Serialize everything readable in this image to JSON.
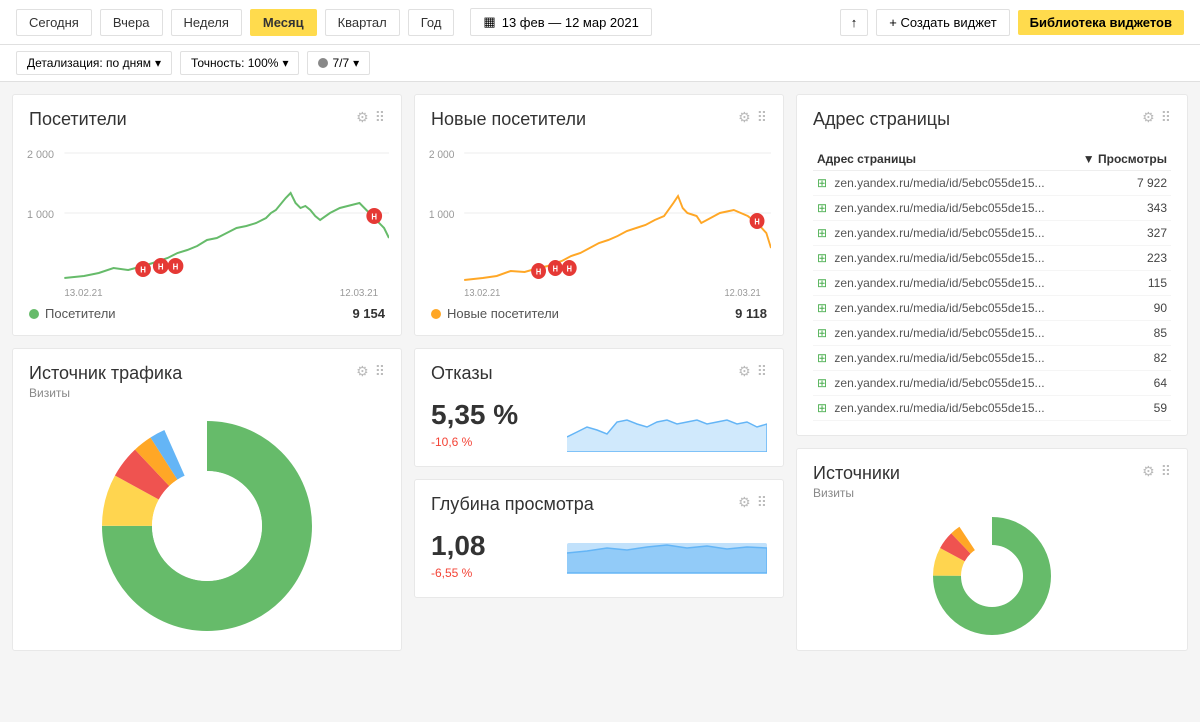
{
  "toolbar": {
    "periods": [
      "Сегодня",
      "Вчера",
      "Неделя",
      "Месяц",
      "Квартал",
      "Год"
    ],
    "active_period": "Месяц",
    "date_range": "13 фев — 12 мар 2021",
    "upload_label": "↑",
    "create_widget_label": "+ Создать виджет",
    "library_label": "Библиотека виджетов"
  },
  "toolbar2": {
    "detail_label": "Детализация: по дням",
    "accuracy_label": "Точность: 100%",
    "count_label": "7/7"
  },
  "visitors_widget": {
    "title": "Посетители",
    "legend_label": "Посетители",
    "legend_value": "9 154",
    "legend_color": "#4caf50",
    "y_labels": [
      "2 000",
      "1 000"
    ],
    "x_labels": [
      "13.02.21",
      "12.03.21"
    ]
  },
  "new_visitors_widget": {
    "title": "Новые посетители",
    "legend_label": "Новые посетители",
    "legend_value": "9 118",
    "legend_color": "#ffa726",
    "y_labels": [
      "2 000",
      "1 000"
    ],
    "x_labels": [
      "13.02.21",
      "12.03.21"
    ]
  },
  "address_widget": {
    "title": "Адрес страницы",
    "col1": "Адрес страницы",
    "col2": "Просмотры",
    "rows": [
      {
        "url": "zen.yandex.ru/media/id/5ebc055de15...",
        "views": "7 922"
      },
      {
        "url": "zen.yandex.ru/media/id/5ebc055de15...",
        "views": "343"
      },
      {
        "url": "zen.yandex.ru/media/id/5ebc055de15...",
        "views": "327"
      },
      {
        "url": "zen.yandex.ru/media/id/5ebc055de15...",
        "views": "223"
      },
      {
        "url": "zen.yandex.ru/media/id/5ebc055de15...",
        "views": "115"
      },
      {
        "url": "zen.yandex.ru/media/id/5ebc055de15...",
        "views": "90"
      },
      {
        "url": "zen.yandex.ru/media/id/5ebc055de15...",
        "views": "85"
      },
      {
        "url": "zen.yandex.ru/media/id/5ebc055de15...",
        "views": "82"
      },
      {
        "url": "zen.yandex.ru/media/id/5ebc055de15...",
        "views": "64"
      },
      {
        "url": "zen.yandex.ru/media/id/5ebc055de15...",
        "views": "59"
      }
    ]
  },
  "traffic_widget": {
    "title": "Источник трафика",
    "subtitle": "Визиты"
  },
  "bounce_widget": {
    "title": "Отказы",
    "value": "5,35 %",
    "change": "-10,6 %",
    "change_type": "negative"
  },
  "depth_widget": {
    "title": "Глубина просмотра",
    "value": "1,08",
    "change": "-6,55 %",
    "change_type": "negative"
  },
  "sources_widget": {
    "title": "Источники",
    "subtitle": "Визиты"
  },
  "icons": {
    "gear": "⚙",
    "grid": "⠿",
    "calendar": "▦",
    "chevron_down": "▾",
    "expand": "＋",
    "upload": "⬆",
    "sort_asc": "▼"
  }
}
